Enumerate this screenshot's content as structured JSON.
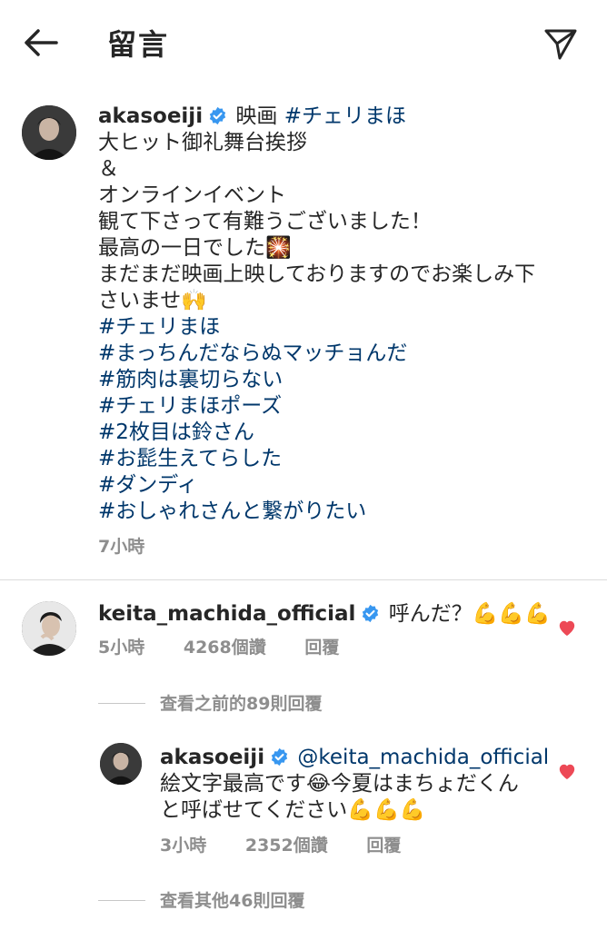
{
  "header": {
    "title": "留言"
  },
  "post": {
    "username": "akasoeiji",
    "first_line_text": "映画",
    "first_line_tag": "#チェリまほ",
    "lines": [
      "大ヒット御礼舞台挨拶",
      "＆",
      "オンラインイベント",
      "観て下さって有難うございました！",
      "最高の一日でした🎇",
      "まだまだ映画上映しておりますのでお楽しみ下",
      "さいませ🙌"
    ],
    "hashtags": [
      "#チェリまほ",
      "#まっちんだならぬマッチョんだ",
      "#筋肉は裏切らない",
      "#チェリまほポーズ",
      "#2枚目は鈴さん",
      "#お髭生えてらした",
      "#ダンディ",
      "#おしゃれさんと繋がりたい"
    ],
    "time": "7小時"
  },
  "comment": {
    "username": "keita_machida_official",
    "text": "呼んだ？💪💪💪",
    "time": "5小時",
    "likes": "4268個讚",
    "reply": "回覆",
    "liked_color": "#ed4956"
  },
  "view_previous": "查看之前的89則回覆",
  "reply": {
    "username": "akasoeiji",
    "mention": "@keita_machida_official",
    "line1": "絵文字最高です😂今夏はまちょだくん",
    "line2": "と呼ばせてください💪💪💪",
    "time": "3小時",
    "likes": "2352個讚",
    "reply": "回覆"
  },
  "view_more": "查看其他46則回覆",
  "colors": {
    "hashtag": "#00376b",
    "verified": "#3897f0",
    "meta": "#8e8e8e",
    "heart": "#ed4956"
  }
}
